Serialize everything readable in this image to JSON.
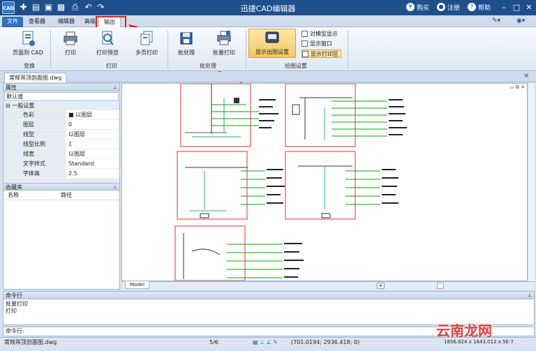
{
  "app": {
    "logo": "CAD",
    "title": "迅捷CAD编辑器"
  },
  "titlebar_right": {
    "buy": "购买",
    "register": "注册",
    "help": "帮助"
  },
  "tabs": [
    "文件",
    "查看器",
    "编辑器",
    "高级",
    "输出"
  ],
  "ribbon": {
    "buttons": {
      "page_to_cad": "页面到 CAD",
      "print": "打印",
      "print_preview": "打印预览",
      "multi_page_print": "多页打印",
      "batch": "批处理",
      "batch_print": "批量打印",
      "show_output_settings": "显示出图设置"
    },
    "checks": [
      "对模型显示",
      "显示窗口",
      "显示打印区"
    ],
    "groups": {
      "convert": "变换",
      "print": "打印",
      "batch": "批处理",
      "plot_settings": "绘图设置"
    }
  },
  "document_tab": "常规吊顶剖面图.dwg",
  "properties": {
    "header": "属性",
    "select_value": "默认值",
    "section": "一般设置",
    "rows": [
      {
        "k": "色彩",
        "v": "■ 以图层"
      },
      {
        "k": "图层",
        "v": "0"
      },
      {
        "k": "线型",
        "v": "以图层"
      },
      {
        "k": "线型比例",
        "v": "1"
      },
      {
        "k": "线宽",
        "v": "以图层"
      },
      {
        "k": "文字样式",
        "v": "Standard"
      },
      {
        "k": "字体高",
        "v": "2.5"
      }
    ]
  },
  "favorites": {
    "header": "收藏夹",
    "col_name": "名称",
    "col_path": "路径"
  },
  "model_tab": "Model",
  "command": {
    "header": "命令行",
    "history": [
      "批量打印",
      "打印"
    ],
    "prompt": "命令行:"
  },
  "status": {
    "file": "常规吊顶剖面图.dwg",
    "page": "5/6",
    "coords": "(701.0194; 2936.418; 0)",
    "size": "1856.824 x 1643.012 x 5E-7"
  },
  "watermark": "云南龙网",
  "colors": {
    "titlebar": "#1e4f8c",
    "accent": "#2e6fc0",
    "highlight": "#f6c761",
    "callout": "#e02020"
  }
}
